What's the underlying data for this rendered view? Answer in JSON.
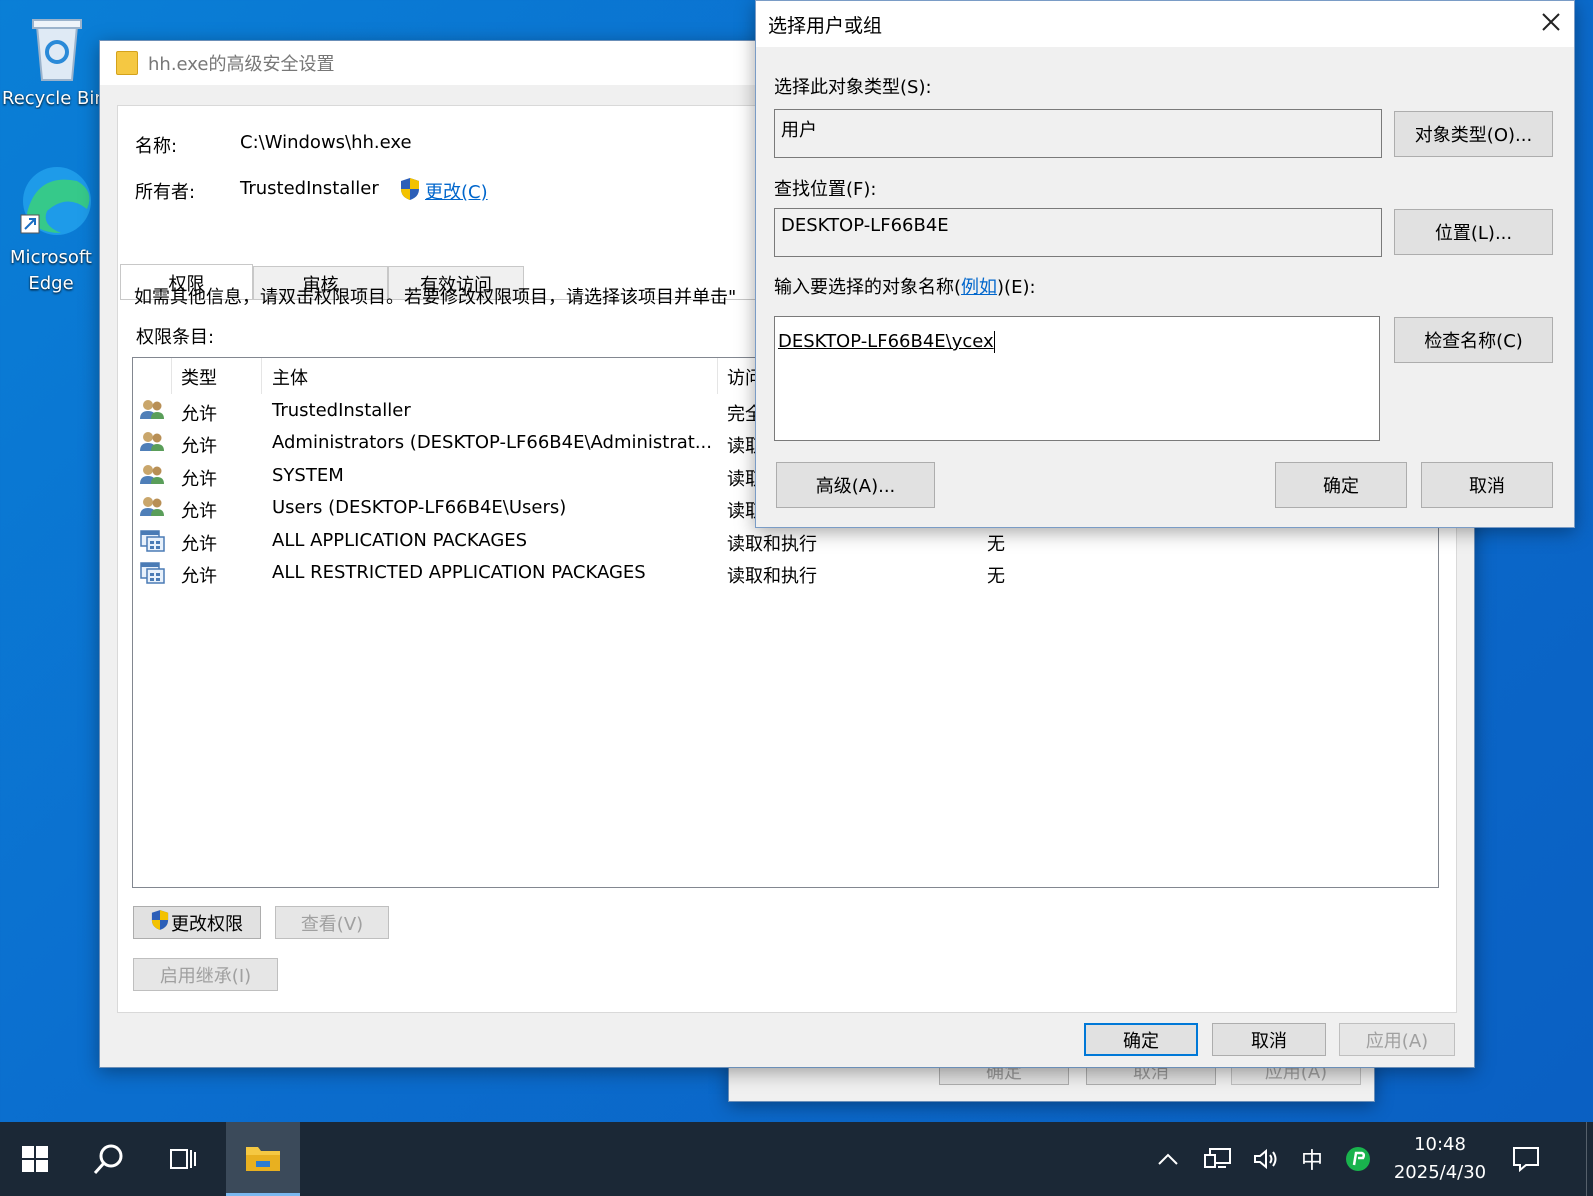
{
  "desktop": {
    "icons": [
      {
        "label": "Recycle Bin",
        "icon": "recycle-bin-icon"
      },
      {
        "label": "Microsoft Edge",
        "icon": "edge-icon"
      }
    ]
  },
  "main_window": {
    "title": "hh.exe的高级安全设置",
    "name_label": "名称:",
    "name_value": "C:\\Windows\\hh.exe",
    "owner_label": "所有者:",
    "owner_value": "TrustedInstaller",
    "owner_change_link": "更改(C)",
    "tabs": [
      "权限",
      "审核",
      "有效访问"
    ],
    "info_text": "如需其他信息，请双击权限项目。若要修改权限项目，请选择该项目并单击\"",
    "entries_label": "权限条目:",
    "columns": [
      "类型",
      "主体",
      "访问"
    ],
    "entries": [
      {
        "icon": "users-icon",
        "type": "允许",
        "principal": "TrustedInstaller",
        "access": "完全",
        "inherited": ""
      },
      {
        "icon": "users-icon",
        "type": "允许",
        "principal": "Administrators (DESKTOP-LF66B4E\\Administrat...",
        "access": "读取",
        "inherited": ""
      },
      {
        "icon": "users-icon",
        "type": "允许",
        "principal": "SYSTEM",
        "access": "读取",
        "inherited": ""
      },
      {
        "icon": "users-icon",
        "type": "允许",
        "principal": "Users (DESKTOP-LF66B4E\\Users)",
        "access": "读取",
        "inherited": ""
      },
      {
        "icon": "packages-icon",
        "type": "允许",
        "principal": "ALL APPLICATION PACKAGES",
        "access": "读取和执行",
        "inherited": "无"
      },
      {
        "icon": "packages-icon",
        "type": "允许",
        "principal": "ALL RESTRICTED APPLICATION PACKAGES",
        "access": "读取和执行",
        "inherited": "无"
      }
    ],
    "change_permissions_button": "更改权限",
    "view_button": "查看(V)",
    "enable_inheritance_button": "启用继承(I)",
    "ok_button": "确定",
    "cancel_button": "取消",
    "apply_button": "应用(A)"
  },
  "behind_window": {
    "ok_button": "确定",
    "cancel_button": "取消",
    "apply_button": "应用(A)"
  },
  "select_dialog": {
    "title": "选择用户或组",
    "object_type_label": "选择此对象类型(S):",
    "object_type_value": "用户",
    "object_types_button": "对象类型(O)...",
    "location_label": "查找位置(F):",
    "location_value": "DESKTOP-LF66B4E",
    "locations_button": "位置(L)...",
    "enter_names_label_before": "输入要选择的对象名称(",
    "enter_names_link": "例如",
    "enter_names_label_after": ")(E):",
    "names_value": "DESKTOP-LF66B4E\\ycex",
    "check_names_button": "检查名称(C)",
    "advanced_button": "高级(A)...",
    "ok_button": "确定",
    "cancel_button": "取消"
  },
  "taskbar": {
    "time": "10:48",
    "date": "2025/4/30",
    "ime": "中"
  },
  "colors": {
    "accent": "#0078d7",
    "link": "#0066cc",
    "taskbar": "#1b2836",
    "desktop": "#0a6fcf"
  }
}
